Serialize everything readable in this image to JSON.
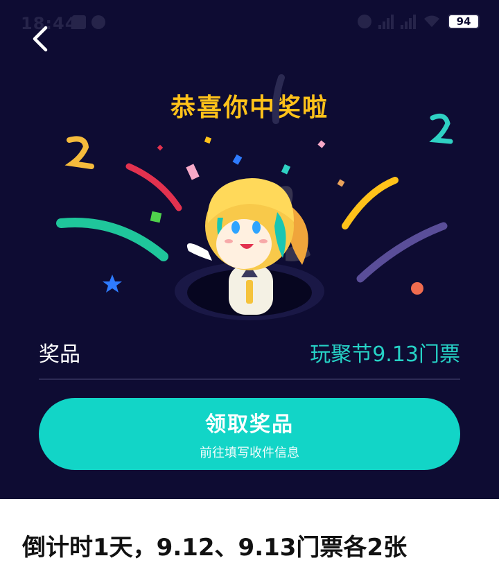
{
  "status_bar": {
    "time": "18:44",
    "battery": "94"
  },
  "header": {
    "congrats_title": "恭喜你中奖啦"
  },
  "prize": {
    "label": "奖品",
    "value": "玩聚节9.13门票"
  },
  "claim": {
    "title": "领取奖品",
    "subtitle": "前往填写收件信息"
  },
  "notice": {
    "text": "倒计时1天，9.12、9.13门票各2张"
  },
  "colors": {
    "panel_bg": "#0e0c33",
    "accent_teal": "#12d5c7",
    "title_yellow": "#ffc21a"
  },
  "icons": {
    "back": "chevron-left-icon"
  }
}
